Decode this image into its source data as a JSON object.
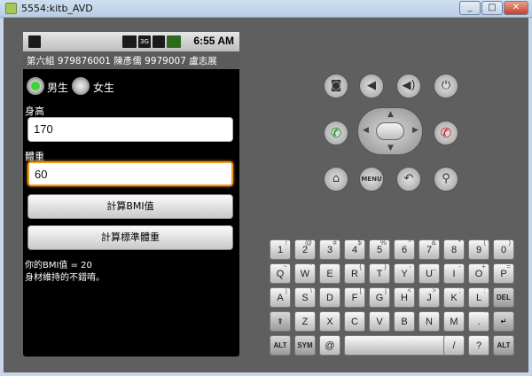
{
  "window": {
    "title": "5554:kitb_AVD",
    "minimize": "_",
    "maximize": "□",
    "close": "✕"
  },
  "statusbar": {
    "time": "6:55 AM",
    "network": "3G"
  },
  "app": {
    "title": "第六組 979876001 陳彥儒 9979007 盧志展",
    "gender": {
      "male": "男生",
      "female": "女生",
      "selected": "male"
    },
    "height": {
      "label": "身高",
      "value": "170"
    },
    "weight": {
      "label": "體重",
      "value": "60"
    },
    "calc_bmi_button": "計算BMI值",
    "calc_ideal_button": "計算標準體重",
    "result_line1": "你的BMI值 = 20",
    "result_line2": "身材維持的不錯唷。"
  },
  "controls": {
    "camera": "camera-icon",
    "vol_down": "volume-down-icon",
    "vol_up": "volume-up-icon",
    "power": "power-icon",
    "call": "call-icon",
    "end_call": "end-call-icon",
    "home": "home-icon",
    "menu": "MENU",
    "back": "back-icon",
    "search": "search-icon"
  },
  "keyboard": {
    "row1": [
      [
        "1",
        "!"
      ],
      [
        "2",
        "@"
      ],
      [
        "3",
        "#"
      ],
      [
        "4",
        "$"
      ],
      [
        "5",
        "%"
      ],
      [
        "6",
        "^"
      ],
      [
        "7",
        "&"
      ],
      [
        "8",
        "*"
      ],
      [
        "9",
        "("
      ],
      [
        "0",
        ")"
      ]
    ],
    "row2": [
      [
        "Q",
        "~"
      ],
      [
        "W",
        "\""
      ],
      [
        "E",
        "`"
      ],
      [
        "R",
        "{"
      ],
      [
        "T",
        "}"
      ],
      [
        "Y",
        "-"
      ],
      [
        "U",
        "_"
      ],
      [
        "I",
        "-"
      ],
      [
        "O",
        "+"
      ],
      [
        "P",
        "="
      ]
    ],
    "row3": [
      [
        "A",
        "|"
      ],
      [
        "S",
        "\\"
      ],
      [
        "D",
        " "
      ],
      [
        "F",
        "["
      ],
      [
        "G",
        "]"
      ],
      [
        "H",
        "<"
      ],
      [
        "J",
        ">"
      ],
      [
        "K",
        ";"
      ],
      [
        "L",
        ":"
      ],
      [
        "DEL",
        ""
      ]
    ],
    "row4": [
      [
        "⇧",
        ""
      ],
      [
        "Z",
        ""
      ],
      [
        "X",
        ""
      ],
      [
        "C",
        ""
      ],
      [
        "V",
        ""
      ],
      [
        "B",
        ""
      ],
      [
        "N",
        ""
      ],
      [
        "M",
        ""
      ],
      [
        ".",
        "'"
      ],
      [
        "↵",
        ""
      ]
    ],
    "row5": {
      "alt": "ALT",
      "sym": "SYM",
      "at": "@",
      "space": "",
      "slash": "/",
      "comma": "?",
      "alt2": "ALT"
    }
  }
}
